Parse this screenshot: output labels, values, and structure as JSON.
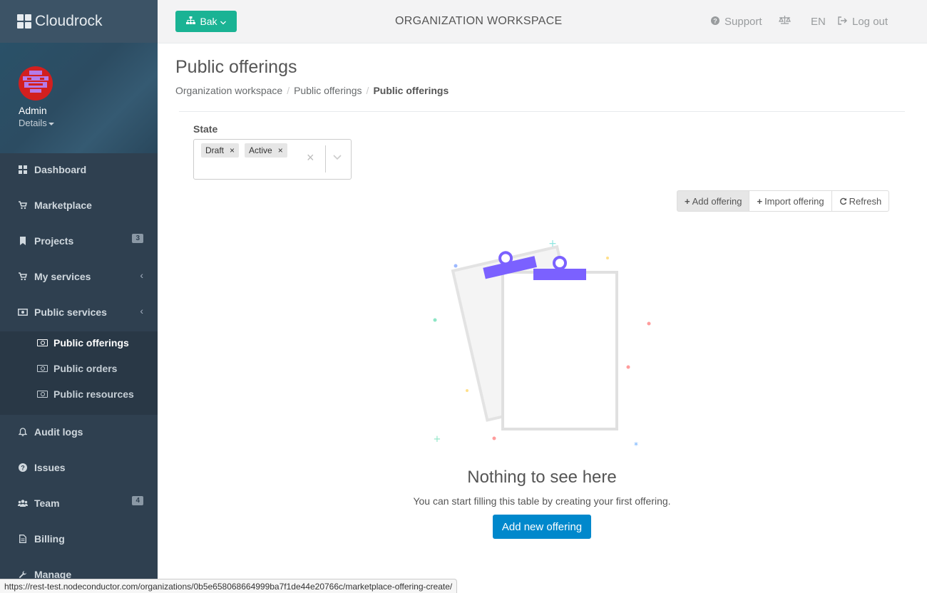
{
  "app": {
    "name": "Cloudrock"
  },
  "profile": {
    "name": "Admin",
    "details_label": "Details"
  },
  "sidebar": {
    "items": [
      {
        "label": "Dashboard",
        "icon": "dashboard-icon"
      },
      {
        "label": "Marketplace",
        "icon": "cart-icon"
      },
      {
        "label": "Projects",
        "icon": "bookmark-icon",
        "badge": "3"
      },
      {
        "label": "My services",
        "icon": "cart-icon",
        "chevron": "‹"
      },
      {
        "label": "Public services",
        "icon": "money-icon",
        "chevron": "‹"
      },
      {
        "label": "Audit logs",
        "icon": "bell-icon"
      },
      {
        "label": "Issues",
        "icon": "question-icon"
      },
      {
        "label": "Team",
        "icon": "users-icon",
        "badge": "4"
      },
      {
        "label": "Billing",
        "icon": "file-icon"
      },
      {
        "label": "Manage",
        "icon": "wrench-icon"
      }
    ],
    "subitems": [
      {
        "label": "Public offerings",
        "active": true
      },
      {
        "label": "Public orders"
      },
      {
        "label": "Public resources"
      }
    ]
  },
  "topbar": {
    "org_button": "Bak",
    "title": "ORGANIZATION WORKSPACE",
    "support": "Support",
    "language": "EN",
    "logout": "Log out"
  },
  "page": {
    "title": "Public offerings",
    "breadcrumb": [
      "Organization workspace",
      "Public offerings",
      "Public offerings"
    ]
  },
  "filter": {
    "label": "State",
    "tags": [
      "Draft",
      "Active"
    ]
  },
  "actions": {
    "add": "Add offering",
    "import": "Import offering",
    "refresh": "Refresh"
  },
  "empty": {
    "title": "Nothing to see here",
    "subtitle": "You can start filling this table by creating your first offering.",
    "button": "Add new offering"
  },
  "status_bar": {
    "url": "https://rest-test.nodeconductor.com/organizations/0b5e658068664999ba7f1de44e20766c/marketplace-offering-create/"
  },
  "colors": {
    "sidebar": "#2f4050",
    "accent_green": "#1ab394",
    "primary_blue": "#0088cc",
    "clip_purple": "#7b61ff"
  }
}
